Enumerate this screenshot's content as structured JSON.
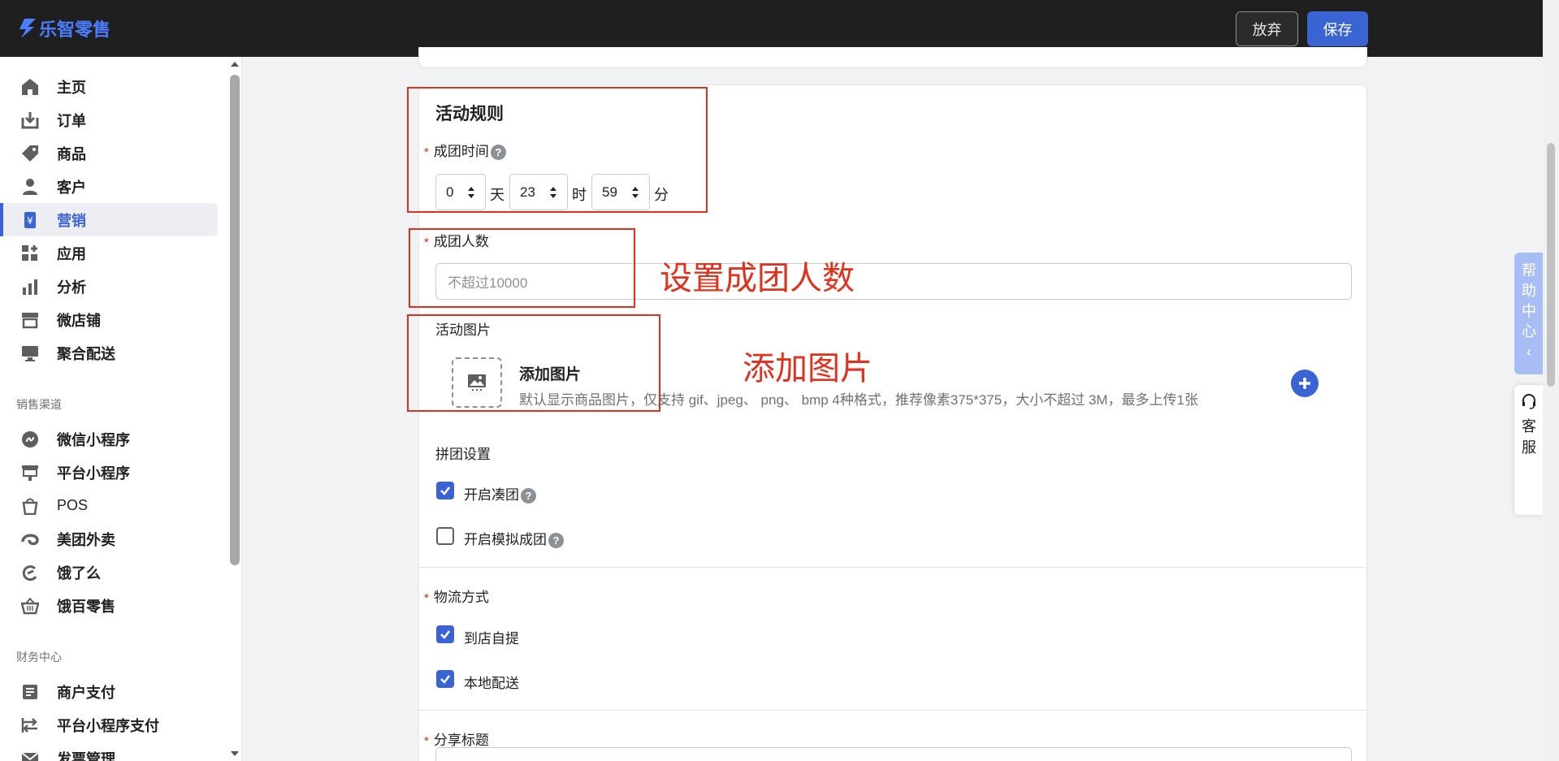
{
  "app": {
    "logo_text": "乐智零售"
  },
  "topbar": {
    "discard_label": "放弃",
    "save_label": "保存"
  },
  "sidebar": {
    "main_items": [
      {
        "label": "主页",
        "icon": "home-icon"
      },
      {
        "label": "订单",
        "icon": "order-icon"
      },
      {
        "label": "商品",
        "icon": "tag-icon"
      },
      {
        "label": "客户",
        "icon": "user-icon"
      },
      {
        "label": "营销",
        "icon": "marketing-icon",
        "active": true
      },
      {
        "label": "应用",
        "icon": "apps-icon"
      },
      {
        "label": "分析",
        "icon": "chart-icon"
      },
      {
        "label": "微店铺",
        "icon": "store-icon"
      },
      {
        "label": "聚合配送",
        "icon": "delivery-icon"
      }
    ],
    "channels_title": "销售渠道",
    "channel_items": [
      {
        "label": "微信小程序",
        "icon": "wechat-miniapp-icon"
      },
      {
        "label": "平台小程序",
        "icon": "platform-miniapp-icon"
      },
      {
        "label": "POS",
        "icon": "pos-bag-icon"
      },
      {
        "label": "美团外卖",
        "icon": "meituan-icon"
      },
      {
        "label": "饿了么",
        "icon": "eleme-icon"
      },
      {
        "label": "饿百零售",
        "icon": "basket-icon"
      }
    ],
    "finance_title": "财务中心",
    "finance_items": [
      {
        "label": "商户支付",
        "icon": "payment-icon"
      },
      {
        "label": "平台小程序支付",
        "icon": "transfer-icon"
      },
      {
        "label": "发票管理",
        "icon": "invoice-icon"
      }
    ]
  },
  "form": {
    "section_title": "活动规则",
    "group_time_label": "成团时间",
    "group_time": {
      "days": "0",
      "day_unit": "天",
      "hours": "23",
      "hour_unit": "时",
      "minutes": "59",
      "minute_unit": "分"
    },
    "group_size_label": "成团人数",
    "group_size_placeholder": "不超过10000",
    "activity_image_label": "活动图片",
    "add_image_title": "添加图片",
    "add_image_hint": "默认显示商品图片，仅支持 gif、jpeg、 png、 bmp 4种格式，推荐像素375*375，大小不超过 3M，最多上传1张",
    "group_settings_label": "拼团设置",
    "enable_gather_label": "开启凑团",
    "enable_gather_checked": true,
    "enable_mock_label": "开启模拟成团",
    "enable_mock_checked": false,
    "logistics_label": "物流方式",
    "pickup_label": "到店自提",
    "pickup_checked": true,
    "local_delivery_label": "本地配送",
    "local_delivery_checked": true,
    "share_title_label": "分享标题"
  },
  "annotations": {
    "set_group_size": "设置成团人数",
    "add_image": "添加图片"
  },
  "float": {
    "help_center_chars": [
      "帮",
      "助",
      "中",
      "心",
      "‹"
    ],
    "service_chars": [
      "客",
      "服"
    ]
  },
  "colors": {
    "accent": "#3a63d3",
    "annotation": "#e1311d",
    "topbar": "#1f1f1f"
  }
}
